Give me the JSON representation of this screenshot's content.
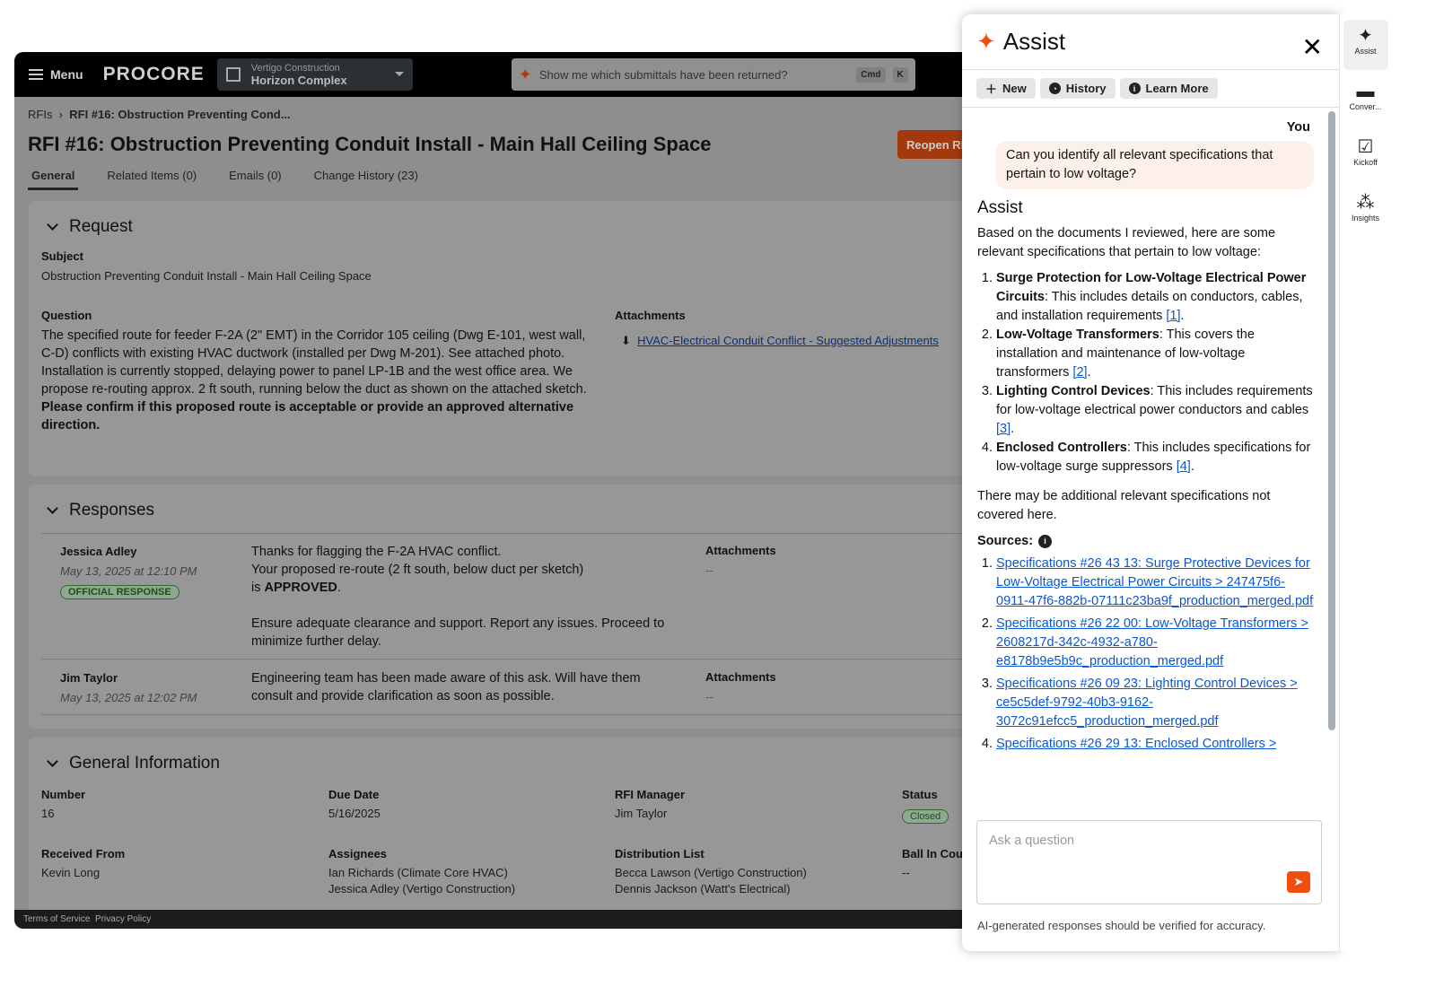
{
  "topbar": {
    "menu": "Menu",
    "logo": "PROCORE",
    "company": "Vertigo Construction",
    "project": "Horizon Complex",
    "search": "Show me which submittals have been returned?",
    "kbd1": "Cmd",
    "kbd2": "K"
  },
  "breadcrumb": {
    "root": "RFIs",
    "current": "RFI #16: Obstruction Preventing Cond..."
  },
  "title": "RFI #16: Obstruction Preventing Conduit Install - Main Hall Ceiling Space",
  "reopen": "Reopen RFI",
  "tabs": [
    "General",
    "Related Items (0)",
    "Emails (0)",
    "Change History (23)"
  ],
  "request": {
    "heading": "Request",
    "subject_label": "Subject",
    "subject": "Obstruction Preventing Conduit Install - Main Hall Ceiling Space",
    "question_label": "Question",
    "question": "The specified route for feeder F-2A (2\" EMT) in the Corridor 105 ceiling (Dwg E-101, west wall, C-D) conflicts with existing HVAC ductwork (installed per Dwg M-201). See attached photo. Installation is currently stopped, delaying power to panel LP-1B and the west office area. We propose re-routing approx. 2 ft south, running below the duct as shown on the attached sketch.",
    "question_bold": "Please confirm if this proposed route is acceptable or provide an approved alternative direction.",
    "attachments_label": "Attachments",
    "attachment": "HVAC-Electrical Conduit Conflict - Suggested Adjustments"
  },
  "responses": {
    "heading": "Responses",
    "items": [
      {
        "name": "Jessica Adley",
        "date": "May 13, 2025 at 12:10 PM",
        "badge": "OFFICIAL RESPONSE",
        "l1": "Thanks for flagging the F-2A HVAC conflict.",
        "l2": "Your proposed re-route (2 ft south, below duct per sketch)",
        "l3a": "is ",
        "l3b": "APPROVED",
        "l3c": ".",
        "l4": "Ensure adequate clearance and support. Report any issues. Proceed to minimize further delay.",
        "att_label": "Attachments",
        "att": "--"
      },
      {
        "name": "Jim Taylor",
        "date": "May 13, 2025 at 12:02 PM",
        "text": "Engineering team has been made aware of this ask. Will have them consult and provide clarification as soon as possible.",
        "att_label": "Attachments",
        "att": "--"
      }
    ]
  },
  "general": {
    "heading": "General Information",
    "number_label": "Number",
    "number": "16",
    "due_label": "Due Date",
    "due": "5/16/2025",
    "manager_label": "RFI Manager",
    "manager": "Jim Taylor",
    "status_label": "Status",
    "status": "Closed",
    "received_label": "Received From",
    "received": "Kevin Long",
    "assignees_label": "Assignees",
    "assignees": [
      "Ian Richards (Climate Core HVAC)",
      "Jessica Adley (Vertigo Construction)"
    ],
    "dist_label": "Distribution List",
    "dist": [
      "Becca Lawson (Vertigo Construction)",
      "Dennis Jackson (Watt's Electrical)"
    ],
    "ball_label": "Ball In Court",
    "ball": "--"
  },
  "footer": {
    "terms": "Terms of Service",
    "privacy": "Privacy Policy"
  },
  "assist": {
    "title": "Assist",
    "new": "New",
    "history": "History",
    "learn": "Learn More",
    "you": "You",
    "question": "Can you identify all relevant specifications that pertain to low voltage?",
    "responder": "Assist",
    "intro": "Based on the documents I reviewed, here are some relevant specifications that pertain to low voltage:",
    "items": [
      {
        "bold": "Surge Protection for Low-Voltage Electrical Power Circuits",
        "text": ": This includes details on conductors, cables, and installation requirements ",
        "ref": "[1]"
      },
      {
        "bold": "Low-Voltage Transformers",
        "text": ": This covers the installation and maintenance of low-voltage transformers ",
        "ref": "[2]"
      },
      {
        "bold": "Lighting Control Devices",
        "text": ": This includes requirements for low-voltage electrical power conductors and cables ",
        "ref": "[3]"
      },
      {
        "bold": "Enclosed Controllers",
        "text": ": This includes specifications for low-voltage surge suppressors ",
        "ref": "[4]"
      }
    ],
    "outro": "There may be additional relevant specifications not covered here.",
    "sources_label": "Sources:",
    "sources": [
      "Specifications #26 43 13: Surge Protective Devices for Low-Voltage Electrical Power Circuits > 247475f6-0911-47f6-882b-07111c23ba9f_production_merged.pdf",
      "Specifications #26 22 00: Low-Voltage Transformers > 2608217d-342c-4932-a780-e8178b9e5b9c_production_merged.pdf",
      "Specifications #26 09 23: Lighting Control Devices > ce5c5def-9792-40b3-9162-3072c91efcc5_production_merged.pdf",
      "Specifications #26 29 13: Enclosed Controllers >"
    ],
    "placeholder": "Ask a question",
    "disclaimer": "AI-generated responses should be verified for accuracy."
  },
  "rail": [
    "Assist",
    "Conver...",
    "Kickoff",
    "Insights"
  ],
  "colors": {
    "accent": "#f04e0f",
    "link": "#0b57d0",
    "bubble": "#fdf0ea"
  }
}
